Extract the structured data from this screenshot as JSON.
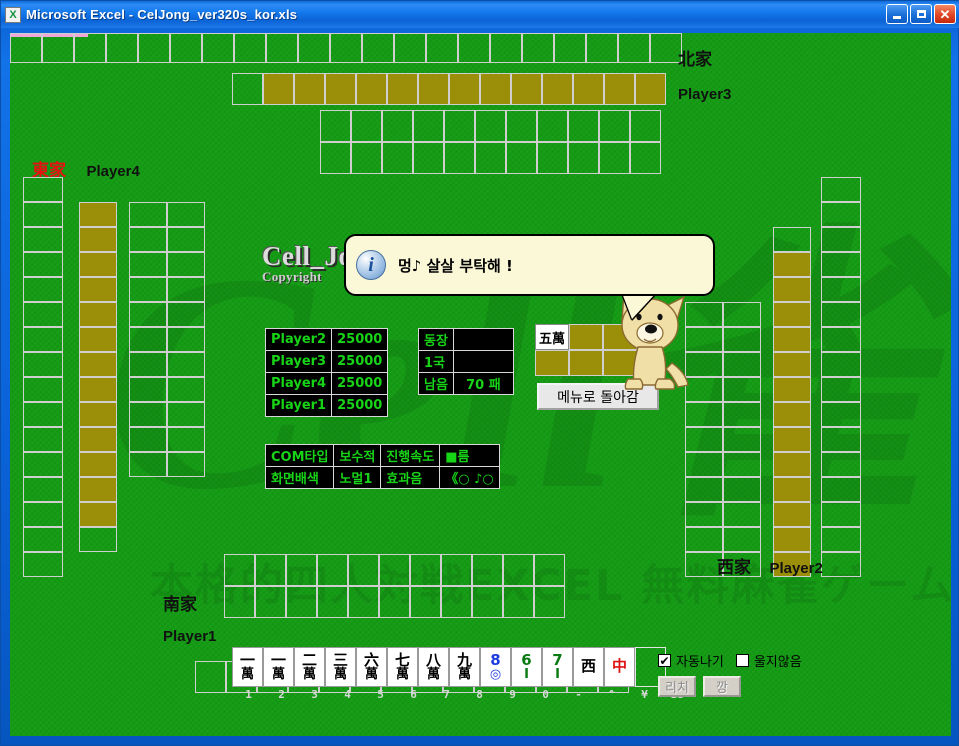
{
  "window": {
    "title": "Microsoft Excel - CelJong_ver320s_kor.xls",
    "icon": "excel-icon",
    "minimize": "_",
    "maximize": "□",
    "close": "✕"
  },
  "logo": {
    "line1": "Cell_Jong",
    "line2": "Copyright"
  },
  "watermark": {
    "big": "Cell雀",
    "tagline": "本格的四人対戦EXCEL 無料麻雀ゲーム Cell 雀"
  },
  "seats": {
    "north": {
      "wind": "北家",
      "player": "Player3"
    },
    "east": {
      "wind": "東家",
      "player": "Player4"
    },
    "west": {
      "wind": "西家",
      "player": "Player2"
    },
    "south": {
      "wind": "南家",
      "player": "Player1"
    }
  },
  "balloon": {
    "text": "멍♪ 살살 부탁해 !",
    "icon": "info-icon"
  },
  "scores": {
    "rows": [
      {
        "name": "Player2",
        "points": "25000"
      },
      {
        "name": "Player3",
        "points": "25000"
      },
      {
        "name": "Player4",
        "points": "25000"
      },
      {
        "name": "Player1",
        "points": "25000"
      }
    ]
  },
  "round": {
    "rows": [
      {
        "label": "동장",
        "value": ""
      },
      {
        "label": "1국",
        "value": ""
      },
      {
        "label": "남음",
        "value": "70 패"
      }
    ]
  },
  "settings": {
    "rows": [
      {
        "k1": "COM타입",
        "v1": "보수적",
        "k2": "진행속도",
        "v2": "■름"
      },
      {
        "k1": "화면배색",
        "v1": "노멀1",
        "k2": "효과음",
        "v2": "《○ ♪○"
      }
    ]
  },
  "drawn_tile": {
    "label1": "五",
    "label2": "萬"
  },
  "menu_button": {
    "label": "메뉴로 돌아감"
  },
  "hand": {
    "tiles": [
      {
        "t1": "一",
        "t2": "萬",
        "suit": "man"
      },
      {
        "t1": "一",
        "t2": "萬",
        "suit": "man"
      },
      {
        "t1": "二",
        "t2": "萬",
        "suit": "man"
      },
      {
        "t1": "三",
        "t2": "萬",
        "suit": "man"
      },
      {
        "t1": "六",
        "t2": "萬",
        "suit": "man"
      },
      {
        "t1": "七",
        "t2": "萬",
        "suit": "man"
      },
      {
        "t1": "八",
        "t2": "萬",
        "suit": "man"
      },
      {
        "t1": "九",
        "t2": "萬",
        "suit": "man"
      },
      {
        "t1": "8",
        "t2": "◎",
        "suit": "pin"
      },
      {
        "t1": "6",
        "t2": "I",
        "suit": "sou"
      },
      {
        "t1": "7",
        "t2": "I",
        "suit": "sou"
      },
      {
        "t1": "西",
        "t2": "",
        "suit": "man"
      },
      {
        "t1": "中",
        "t2": "",
        "suit": "red"
      },
      {
        "t1": "",
        "t2": "",
        "suit": "blankdraw"
      }
    ],
    "keys": [
      "1",
      "2",
      "3",
      "4",
      "5",
      "6",
      "7",
      "8",
      "9",
      "0",
      "-",
      "^",
      "¥",
      "BS"
    ]
  },
  "controls": {
    "auto_win": {
      "label": "자동나기",
      "checked": true,
      "mark": "✔"
    },
    "no_call": {
      "label": "울지않음",
      "checked": false,
      "mark": ""
    },
    "riichi_button": "리치",
    "kan_button": "깡"
  },
  "colors": {
    "felt": "#139b13",
    "tile_back": "#9b8f09",
    "panel_text": "#17d417",
    "title_bar": "#1379ec",
    "balloon": "#fbf8d8"
  }
}
